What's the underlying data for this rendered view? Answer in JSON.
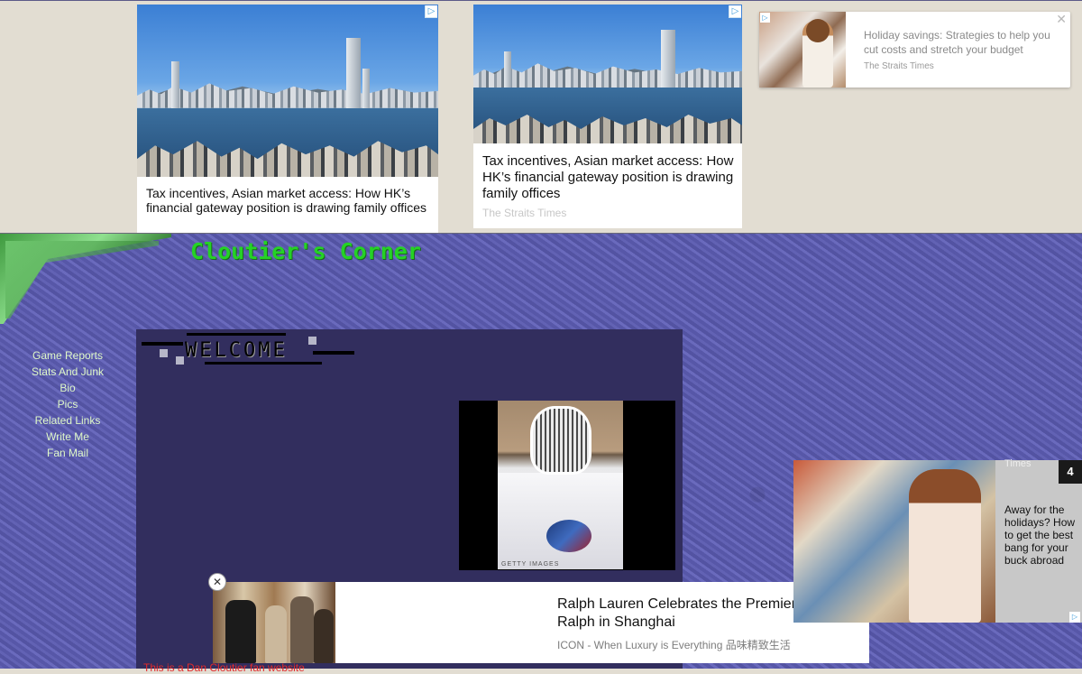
{
  "top_ads": {
    "ad1": {
      "headline": "Tax incentives, Asian market access: How HK’s financial gateway position is drawing family offices",
      "adchoice": "▷"
    },
    "ad2": {
      "headline": "Tax incentives, Asian market access: How HK’s financial gateway position is drawing family offices",
      "source": "The Straits Times",
      "adchoice": "▷"
    },
    "ad3": {
      "headline": "Holiday savings: Strategies to help you cut costs and stretch your budget",
      "source": "The Straits Times",
      "close": "✕",
      "adchoice": "▷"
    }
  },
  "site": {
    "title": "Cloutier's Corner",
    "nav": [
      "Game Reports",
      "Stats And Junk",
      "Bio",
      "Pics",
      "Related Links",
      "Write Me",
      "Fan Mail"
    ],
    "welcome": "WELCOME",
    "photo_credit": "GETTY IMAGES",
    "note": "This is a Dan Cloutier fan website"
  },
  "bottom_ad": {
    "headline_line1": "Ralph Lauren Celebrates the Premiere of the HBO Documentary Film Very",
    "headline_line2": "Ralph in Shanghai",
    "source": "ICON - When Luxury is Everything 品味精致生活",
    "close": "✕"
  },
  "side_ad": {
    "times": "Times",
    "count": "4",
    "headline": "Away for the holidays? How to get the best bang for your buck abroad",
    "adchoice": "▷"
  },
  "colors": {
    "site_bg": "#5b5bac",
    "title": "#25d225",
    "nav_link": "#dff8c8",
    "content_bg": "#322e5e",
    "note": "#e32a2a"
  }
}
